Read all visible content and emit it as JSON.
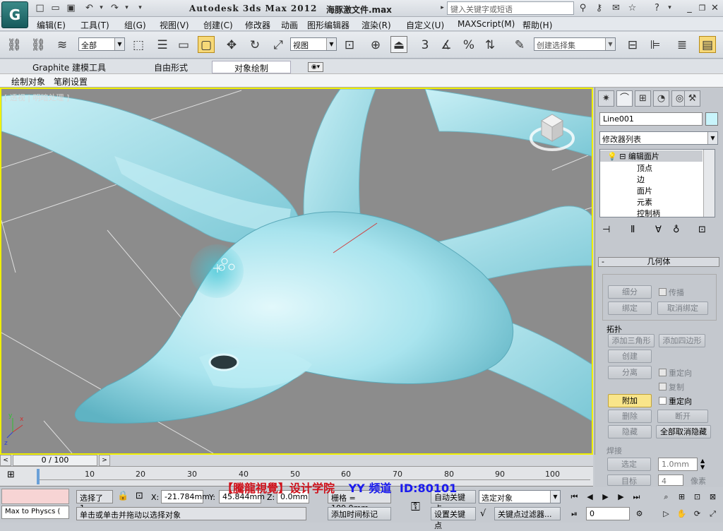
{
  "window": {
    "app_title": "Autodesk 3ds Max  2012",
    "file_name": "海豚激文件.max",
    "search_placeholder": "键入关键字或短语"
  },
  "menu": [
    "编辑(E)",
    "工具(T)",
    "组(G)",
    "视图(V)",
    "创建(C)",
    "修改器",
    "动画",
    "图形编辑器",
    "渲染(R)",
    "自定义(U)",
    "MAXScript(M)",
    "帮助(H)"
  ],
  "toolbar": {
    "selection_filter": "全部",
    "reference_coord": "视图",
    "named_selection_placeholder": "创建选择集",
    "snap_label": "3",
    "percent_label": "%"
  },
  "ribbon": {
    "tabs": [
      "Graphite 建模工具",
      "自由形式",
      "对象绘制"
    ],
    "active_tab": "对象绘制",
    "subtabs": [
      "绘制对象",
      "笔刷设置"
    ]
  },
  "viewport": {
    "label": "[ 透视 | 明暗处理 ]",
    "border_color": "#f0f000",
    "model_color": "#a9e4ee"
  },
  "command_panel": {
    "object_name": "Line001",
    "modifier_list": "修改器列表",
    "stack": [
      "编辑面片",
      "顶点",
      "边",
      "面片",
      "元素",
      "控制柄"
    ],
    "rollout_title": "几何体",
    "groups": {
      "subdivide": "细分",
      "propagate": "传播",
      "bind": "绑定",
      "unbind": "取消绑定",
      "topology": "拓扑",
      "add_tri": "添加三角形",
      "add_quad": "添加四边形",
      "create": "创建",
      "detach": "分离",
      "reorient1": "重定向",
      "copy": "复制",
      "attach": "附加",
      "reorient2": "重定向",
      "delete": "删除",
      "break": "断开",
      "hide": "隐藏",
      "unhide_all": "全部取消隐藏",
      "weld": "焊接",
      "selected": "选定",
      "weld_value": "1.0mm",
      "target": "目标",
      "target_value": "4",
      "pixels": "像素"
    }
  },
  "timeline": {
    "position": "0 / 100",
    "ticks": [
      "10",
      "20",
      "30",
      "40",
      "50",
      "60",
      "70",
      "80",
      "90",
      "100"
    ]
  },
  "status": {
    "script_listener": "Max to Physcs (",
    "selection": "选择了 1",
    "x_label": "X:",
    "x_value": "-21.784mm",
    "y_label": "Y:",
    "y_value": "45.844mm",
    "z_label": "Z:",
    "z_value": "0.0mm",
    "grid": "栅格 = 100.0mm",
    "prompt": "单击或单击并拖动以选择对象",
    "add_time_tag": "添加时间标记",
    "auto_key": "自动关键点",
    "set_key": "设置关键点",
    "key_mode": "选定对象",
    "key_filters": "关键点过滤器...",
    "frame": "0"
  },
  "watermark": {
    "brand": "【騰龍視覺】设计学院",
    "channel": "YY 频道",
    "id": "ID:80101"
  },
  "colors": {
    "accent": "#f0f000",
    "model": "#a9e4ee",
    "watermark_red": "#d0101a",
    "watermark_blue": "#1a1aee"
  }
}
